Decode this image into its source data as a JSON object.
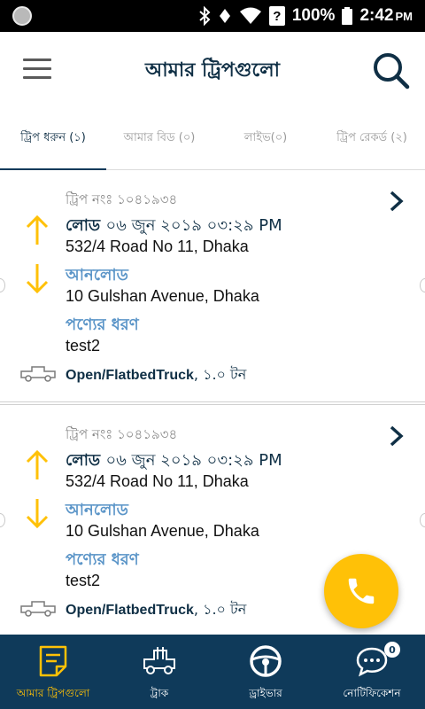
{
  "status_bar": {
    "battery": "100%",
    "time": "2:42",
    "ampm": "PM"
  },
  "app_bar": {
    "title": "আমার ট্রিপগুলো"
  },
  "tabs": [
    {
      "label": "ট্রিপ ধরুন (১)"
    },
    {
      "label": "আমার বিড (০)"
    },
    {
      "label": "লাইভ(০)"
    },
    {
      "label": "ট্রিপ রেকর্ড (২)"
    }
  ],
  "trips": [
    {
      "trip_no": "ট্রিপ নংঃ ১০৪১৯৩৪",
      "load_label": "লোড",
      "load_datetime": "০৬ জুন ২০১৯ ০৩:২৯ PM",
      "load_address": "532/4 Road No 11, Dhaka",
      "unload_label": "আনলোড",
      "unload_address": "10 Gulshan Avenue, Dhaka",
      "goods_label": "পণ্যের ধরণ",
      "goods_value": "test2",
      "truck_type": "Open/FlatbedTruck",
      "truck_capacity": ", ১.০ টন"
    },
    {
      "trip_no": "ট্রিপ নংঃ ১০৪১৯৩৪",
      "load_label": "লোড",
      "load_datetime": "০৬ জুন ২০১৯ ০৩:২৯ PM",
      "load_address": "532/4 Road No 11, Dhaka",
      "unload_label": "আনলোড",
      "unload_address": "10 Gulshan Avenue, Dhaka",
      "goods_label": "পণ্যের ধরণ",
      "goods_value": "test2",
      "truck_type": "Open/FlatbedTruck",
      "truck_capacity": ", ১.০ টন"
    }
  ],
  "bottom_nav": [
    {
      "label": "আমার ট্রিপগুলো",
      "icon": "trips-note-icon"
    },
    {
      "label": "ট্রাক",
      "icon": "truck-icon"
    },
    {
      "label": "ড্রাইভার",
      "icon": "steering-wheel-icon"
    },
    {
      "label": "নোটিফিকেশন",
      "icon": "chat-bubble-icon",
      "badge": "0"
    }
  ],
  "colors": {
    "primary": "#0f3a5a",
    "accent": "#ffc107",
    "label_blue": "#5b95c8"
  }
}
